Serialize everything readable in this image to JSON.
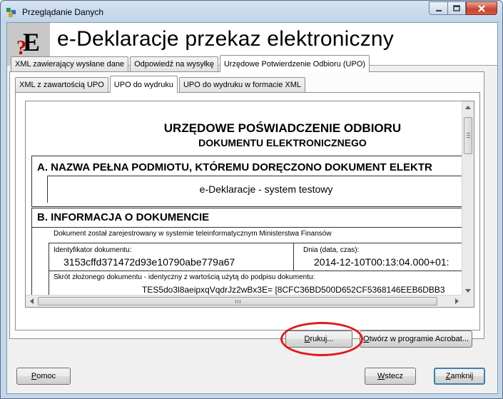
{
  "window": {
    "title": "Przeglądanie Danych"
  },
  "header": {
    "title": "e-Deklaracje przekaz elektroniczny",
    "logo_letter": "E",
    "logo_mark": "?"
  },
  "outer_tabs": [
    {
      "label": "XML zawierający wysłane dane",
      "active": false
    },
    {
      "label": "Odpowiedź na wysyłkę",
      "active": false
    },
    {
      "label": "Urzędowe Potwierdzenie Odbioru (UPO)",
      "active": true
    }
  ],
  "inner_tabs": [
    {
      "label": "XML z zawartością UPO",
      "active": false
    },
    {
      "label": "UPO do wydruku",
      "active": true
    },
    {
      "label": "UPO do wydruku w formacie XML",
      "active": false
    }
  ],
  "document": {
    "title_line1": "URZĘDOWE POŚWIADCZENIE ODBIORU",
    "title_line2": "DOKUMENTU ELEKTRONICZNEGO",
    "section_a": {
      "heading": "A. NAZWA PEŁNA PODMIOTU, KTÓREMU DORĘCZONO DOKUMENT ELEKTR",
      "value": "e-Deklaracje - system testowy"
    },
    "section_b": {
      "heading": "B. INFORMACJA O DOKUMENCIE",
      "note": "Dokument został zarejestrowany w systemie teleinformatycznym Ministerstwa Finansów",
      "id_label": "Identyfikator dokumentu:",
      "id_value": "3153cffd371472d93e10790abe779a67",
      "date_label": "Dnia (data, czas):",
      "date_value": "2014-12-10T00:13:04.000+01:",
      "hash_label": "Skrót złożonego dokumentu - identyczny z wartością użytą do podpisu dokumentu:",
      "hash_value": "TES5do3l8aeipxqVqdrJz2wBx3E= [8CFC36BD500D652CF5368146EEB6DBB3"
    }
  },
  "buttons": {
    "drukuj": {
      "pre": "",
      "hot": "D",
      "post": "rukuj..."
    },
    "otworz": {
      "pre": "",
      "hot": "O",
      "post": "twórz w programie Acrobat..."
    },
    "pomoc": {
      "pre": "",
      "hot": "P",
      "post": "omoc"
    },
    "wstecz": {
      "pre": "",
      "hot": "W",
      "post": "stecz"
    },
    "zamknij": {
      "pre": "",
      "hot": "Z",
      "post": "amknij"
    }
  },
  "colors": {
    "annotation": "#e11a1a",
    "title_bar": "#c4d6ea",
    "close_button": "#c7432e"
  },
  "icons": [
    "app-icon",
    "minimize-icon",
    "maximize-icon",
    "close-icon",
    "scroll-up-icon",
    "scroll-down-icon",
    "scroll-left-icon",
    "scroll-right-icon"
  ]
}
